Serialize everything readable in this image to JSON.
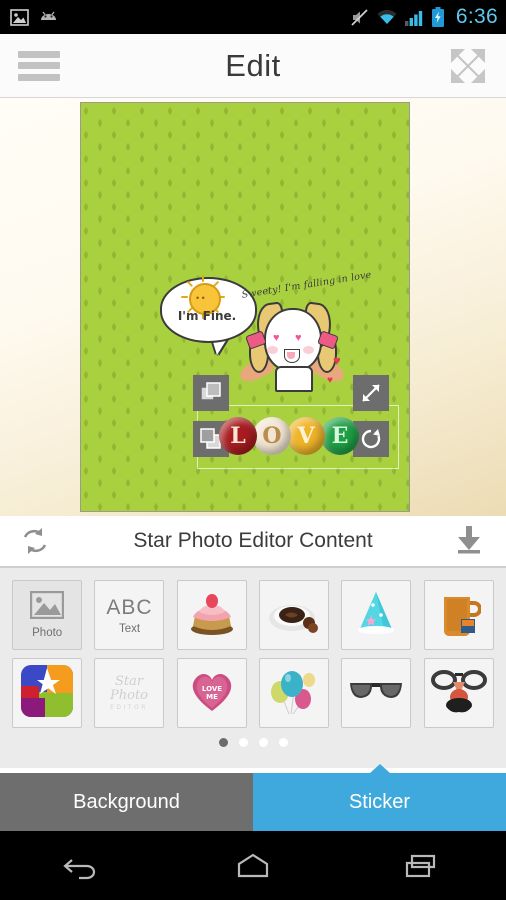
{
  "statusbar": {
    "clock": "6:36",
    "icons": [
      "image-icon",
      "android-mascot-icon",
      "mute-icon",
      "wifi-icon",
      "signal-icon",
      "battery-charging-icon"
    ]
  },
  "header": {
    "title": "Edit",
    "menu_icon": "hamburger-menu-icon",
    "fullscreen_icon": "fullscreen-expand-icon"
  },
  "canvas": {
    "background_color": "#a9d13f",
    "pattern": "droplet-pattern",
    "speech_bubble_text": "I'm Fine.",
    "handwriting_text": "Sweety! I'm falling in love",
    "love_letters": [
      {
        "char": "L",
        "color": "#a81c20",
        "text_color": "#f6e6d6"
      },
      {
        "char": "O",
        "color": "#f2e6d2",
        "text_color": "#b98d52"
      },
      {
        "char": "V",
        "color": "#f0b429",
        "text_color": "#fdf3d0"
      },
      {
        "char": "E",
        "color": "#1fa046",
        "text_color": "#d9f5de"
      }
    ],
    "handles": [
      {
        "name": "bring-to-front-handle",
        "glyph": "front"
      },
      {
        "name": "send-to-back-handle",
        "glyph": "back"
      },
      {
        "name": "resize-handle",
        "glyph": "resize"
      },
      {
        "name": "rotate-handle",
        "glyph": "rotate"
      }
    ]
  },
  "content_bar": {
    "title": "Star Photo Editor Content",
    "refresh_icon": "refresh-icon",
    "download_icon": "download-icon"
  },
  "sticker_grid": {
    "items": [
      {
        "name": "photo-tile",
        "kind": "photo",
        "label": "Photo"
      },
      {
        "name": "text-tile",
        "kind": "text",
        "label": "Text",
        "glyph": "ABC"
      },
      {
        "name": "cake-sticker",
        "kind": "cake",
        "label": ""
      },
      {
        "name": "coffee-sticker",
        "kind": "coffee",
        "label": ""
      },
      {
        "name": "party-hat-sticker",
        "kind": "hat",
        "label": ""
      },
      {
        "name": "beer-mug-sticker",
        "kind": "mug",
        "label": ""
      },
      {
        "name": "star-app-sticker",
        "kind": "star",
        "label": ""
      },
      {
        "name": "watermark-sticker",
        "kind": "watermark",
        "label": "Star Photo EDITOR"
      },
      {
        "name": "love-me-heart-sticker",
        "kind": "heart",
        "label": "LOVE ME"
      },
      {
        "name": "balloons-sticker",
        "kind": "balloons",
        "label": ""
      },
      {
        "name": "sunglasses-sticker",
        "kind": "sunglasses",
        "label": ""
      },
      {
        "name": "disguise-glasses-sticker",
        "kind": "disguise",
        "label": ""
      }
    ],
    "page_dots": 4,
    "active_dot": 0
  },
  "bottom_tabs": {
    "background_label": "Background",
    "sticker_label": "Sticker",
    "active": "Sticker",
    "active_color": "#3fa8dc",
    "inactive_color": "#6e6e6e"
  },
  "navbar": {
    "back_icon": "back-arrow-icon",
    "home_icon": "home-icon",
    "recents_icon": "recent-apps-icon"
  }
}
